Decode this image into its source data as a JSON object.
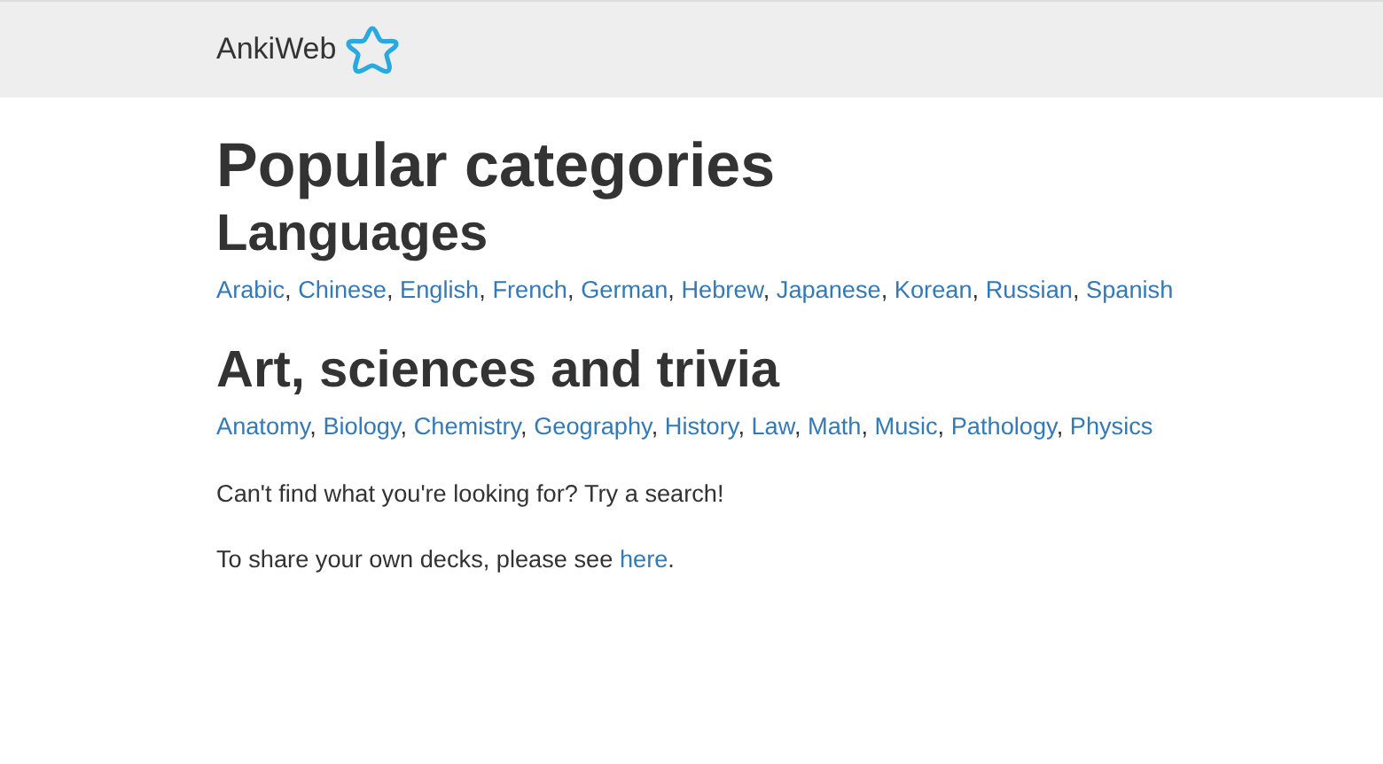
{
  "navbar": {
    "brand": "AnkiWeb"
  },
  "title": "Popular categories",
  "sections": [
    {
      "heading": "Languages",
      "separator": ",",
      "links": [
        "Arabic",
        "Chinese",
        "English",
        "French",
        "German",
        "Hebrew",
        "Japanese",
        "Korean",
        "Russian",
        "Spanish"
      ]
    },
    {
      "heading": "Art, sciences and trivia",
      "separator": ",",
      "links": [
        "Anatomy",
        "Biology",
        "Chemistry",
        "Geography",
        "History",
        "Law",
        "Math",
        "Music",
        "Pathology",
        "Physics"
      ]
    }
  ],
  "search_hint": "Can't find what you're looking for? Try a search!",
  "share_note": {
    "text_before": "To share your own decks, please see ",
    "link": "here",
    "text_after": "."
  }
}
